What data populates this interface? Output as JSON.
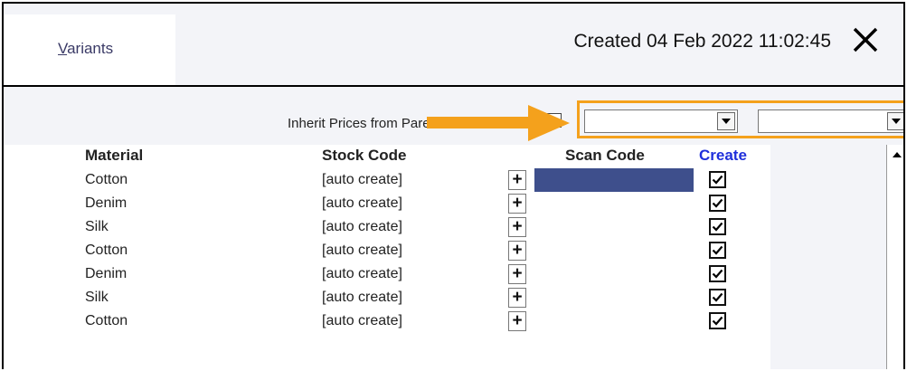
{
  "tab": {
    "accel": "V",
    "rest": "ariants"
  },
  "header": {
    "created": "Created 04 Feb 2022 11:02:45"
  },
  "filters": {
    "inherit_label": "Inherit Prices from Parent",
    "dropdown1": "",
    "dropdown2": ""
  },
  "columns": {
    "material": "Material",
    "stock_code": "Stock Code",
    "scan_code": "Scan Code",
    "create": "Create"
  },
  "rows": [
    {
      "material": "Cotton",
      "stock_code": "[auto create]",
      "plus": "+",
      "scan_code": "",
      "create": true
    },
    {
      "material": "Denim",
      "stock_code": "[auto create]",
      "plus": "+",
      "scan_code": "",
      "create": true
    },
    {
      "material": "Silk",
      "stock_code": "[auto create]",
      "plus": "+",
      "scan_code": "",
      "create": true
    },
    {
      "material": "Cotton",
      "stock_code": "[auto create]",
      "plus": "+",
      "scan_code": "",
      "create": true
    },
    {
      "material": "Denim",
      "stock_code": "[auto create]",
      "plus": "+",
      "scan_code": "",
      "create": true
    },
    {
      "material": "Silk",
      "stock_code": "[auto create]",
      "plus": "+",
      "scan_code": "",
      "create": true
    },
    {
      "material": "Cotton",
      "stock_code": "[auto create]",
      "plus": "+",
      "scan_code": "",
      "create": true
    }
  ],
  "colors": {
    "highlight": "#f4a11c",
    "selected_cell": "#3e4f8c",
    "create_header": "#1f2fdb"
  },
  "icons": {
    "close": "close-icon",
    "arrow": "arrow-right-icon",
    "check": "checkmark-icon"
  }
}
